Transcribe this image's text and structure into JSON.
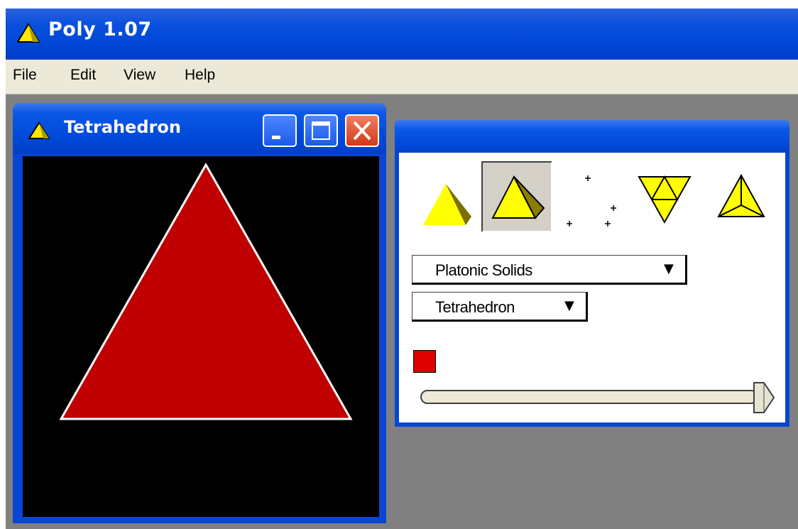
{
  "app": {
    "title": "Poly 1.07",
    "accent": "#0046d8"
  },
  "menu": {
    "items": [
      "File",
      "Edit",
      "View",
      "Help"
    ]
  },
  "child_window": {
    "title": "Tetrahedron",
    "buttons": [
      "minimize-icon",
      "maximize-icon",
      "close-icon"
    ],
    "canvas_background": "#000000",
    "shape_fill": "#c00000",
    "shape_outline": "#ffffff"
  },
  "panel": {
    "tools": [
      "3d-solid-icon",
      "shaded-solid-icon",
      "vertices-icon",
      "net-icon",
      "wireframe-icon"
    ],
    "selected_tool": "shaded-solid-icon",
    "family_select": {
      "value": "Platonic Solids"
    },
    "solid_select": {
      "value": "Tetrahedron"
    },
    "color": "#e00000",
    "slider_fraction": 0.97
  }
}
